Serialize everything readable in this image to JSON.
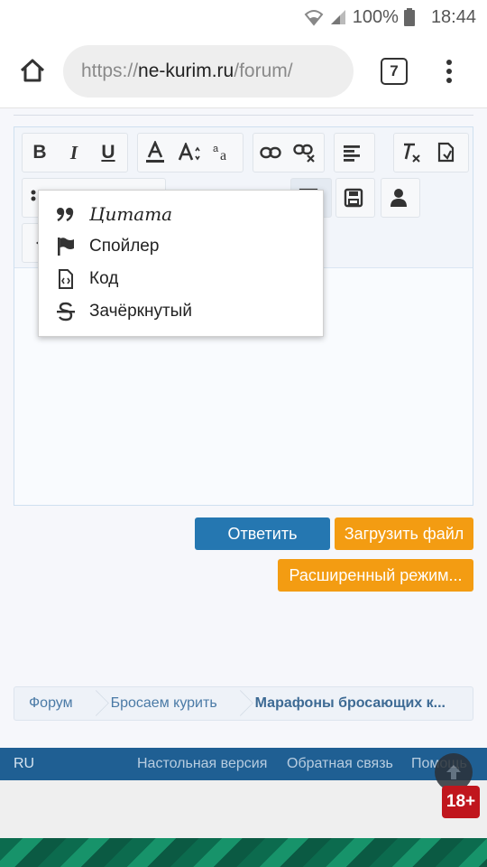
{
  "status_bar": {
    "battery_text": "100%",
    "time": "18:44"
  },
  "browser": {
    "url_scheme": "https://",
    "url_host": "ne-kurim.ru",
    "url_path": "/forum/",
    "tab_count": "7"
  },
  "editor": {
    "toolbar_icons": [
      "bold-icon",
      "italic-icon",
      "underline-icon",
      "font-color-icon",
      "font-size-icon",
      "font-family-icon",
      "link-icon",
      "unlink-icon",
      "align-icon",
      "remove-format-icon",
      "undo-icon",
      "list-icon",
      "save-draft-icon",
      "user-icon"
    ],
    "toolbar_letters": {
      "bold": "B",
      "italic": "I",
      "underline": "U"
    }
  },
  "dropdown": {
    "items": [
      {
        "label": "Цитата",
        "icon": "quote-icon"
      },
      {
        "label": "Спойлер",
        "icon": "flag-icon"
      },
      {
        "label": "Код",
        "icon": "code-file-icon"
      },
      {
        "label": "Зачёркнутый",
        "icon": "strikethrough-icon"
      }
    ]
  },
  "actions": {
    "reply_label": "Ответить",
    "upload_label": "Загрузить файл",
    "advanced_label": "Расширенный режим..."
  },
  "breadcrumb": {
    "items": [
      "Форум",
      "Бросаем курить",
      "Марафоны бросающих к..."
    ]
  },
  "footer": {
    "lang": "RU",
    "links": [
      "Настольная версия",
      "Обратная связь",
      "Помощь"
    ]
  },
  "badge": {
    "age": "18+"
  },
  "colors": {
    "primary_blue": "#2577b1",
    "orange": "#f39c12",
    "footer_blue": "#1f5f93",
    "badge_red": "#c0161d"
  }
}
